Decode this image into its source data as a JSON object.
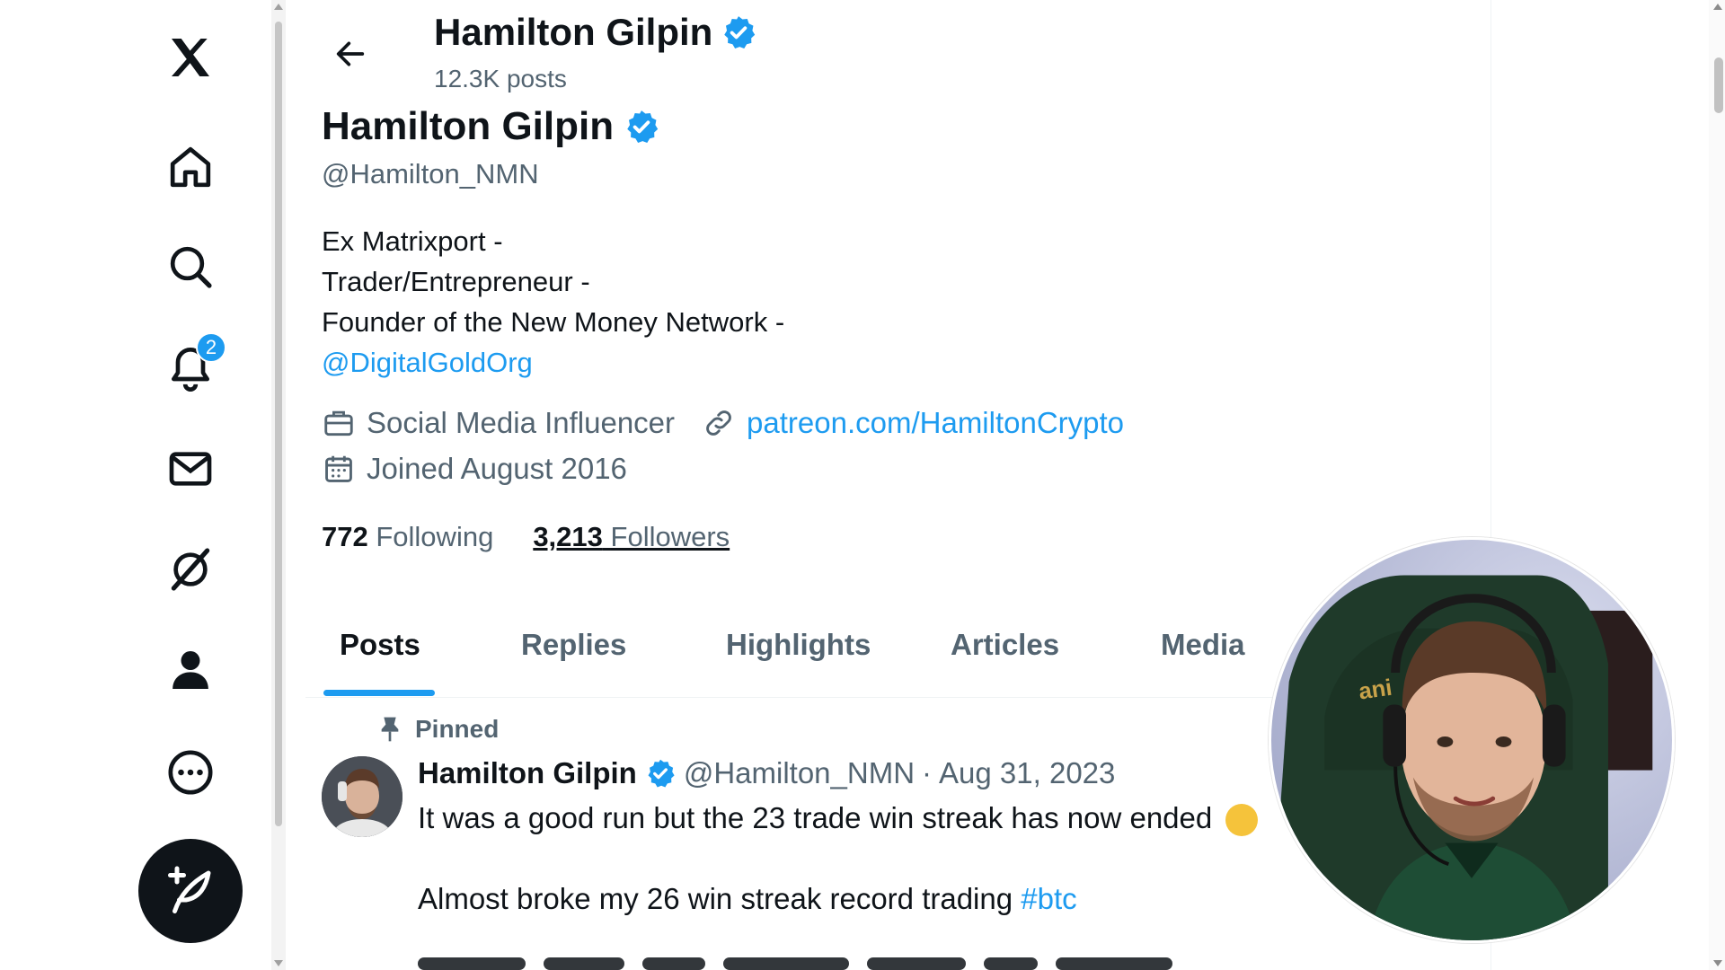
{
  "nav": {
    "items": [
      {
        "id": "logo",
        "icon": "x-logo-icon"
      },
      {
        "id": "home",
        "icon": "home-icon"
      },
      {
        "id": "explore",
        "icon": "search-icon"
      },
      {
        "id": "notifications",
        "icon": "bell-icon",
        "badge": "2"
      },
      {
        "id": "messages",
        "icon": "mail-icon"
      },
      {
        "id": "grok",
        "icon": "grok-icon"
      },
      {
        "id": "profile",
        "icon": "person-icon"
      },
      {
        "id": "more",
        "icon": "more-circle-icon"
      }
    ],
    "compose_icon": "compose-post-icon"
  },
  "header": {
    "name": "Hamilton Gilpin",
    "posts_count": "12.3K posts"
  },
  "profile": {
    "name": "Hamilton Gilpin",
    "handle": "@Hamilton_NMN",
    "bio": {
      "line1": "Ex Matrixport -",
      "line2": "Trader/Entrepreneur -",
      "line3": "Founder of the New Money Network -",
      "mention": "@DigitalGoldOrg"
    },
    "category": "Social Media Influencer",
    "website": "patreon.com/HamiltonCrypto",
    "joined": "Joined August 2016",
    "following_count": "772",
    "following_label": "Following",
    "followers_count": "3,213",
    "followers_label": "Followers"
  },
  "tabs": [
    {
      "label": "Posts",
      "active": true
    },
    {
      "label": "Replies"
    },
    {
      "label": "Highlights"
    },
    {
      "label": "Articles"
    },
    {
      "label": "Media"
    }
  ],
  "tweet": {
    "pinned_label": "Pinned",
    "author": "Hamilton Gilpin",
    "handle": "@Hamilton_NMN",
    "separator": "·",
    "date": "Aug 31, 2023",
    "line1": "It was a good run but the 23 trade win streak has now ended",
    "line2": "Almost broke my 26 win streak record trading",
    "hashtag": "#btc"
  },
  "colors": {
    "accent": "#1d9bf0",
    "text": "#0f1419",
    "muted": "#536471"
  }
}
